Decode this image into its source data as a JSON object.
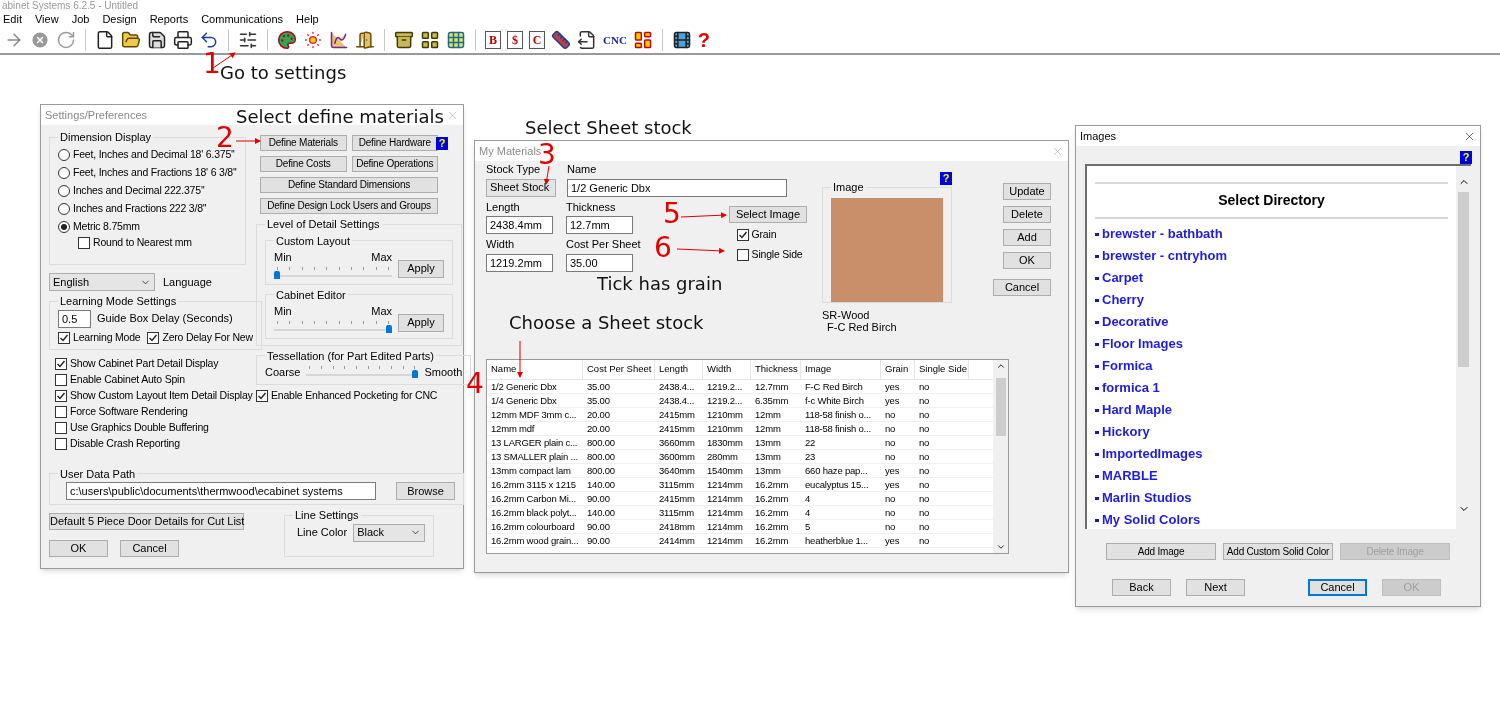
{
  "app": {
    "title": "abinet Systems 6.2.5 - Untitled",
    "menu": [
      "Edit",
      "View",
      "Job",
      "Design",
      "Reports",
      "Communications",
      "Help"
    ],
    "toolbar_glyphs": [
      "B",
      "$",
      "C",
      "CNC",
      "?"
    ]
  },
  "settings": {
    "title": "Settings/Preferences",
    "help": "?",
    "dimension_display": {
      "label": "Dimension Display",
      "options": [
        {
          "label": "Feet, Inches and Decimal 18' 6.375''",
          "selected": false
        },
        {
          "label": "Feet, Inches and Fractions 18' 6 3/8''",
          "selected": false
        },
        {
          "label": "Inches and Decimal 222.375''",
          "selected": false
        },
        {
          "label": "Inches and Fractions 222 3/8''",
          "selected": false
        },
        {
          "label": "Metric 8.75mm",
          "selected": true
        }
      ],
      "round": {
        "label": "Round to Nearest mm",
        "checked": false
      }
    },
    "language": {
      "value": "English",
      "label": "Language"
    },
    "learning": {
      "label": "Learning Mode Settings",
      "delay_value": "0.5",
      "delay_label": "Guide Box Delay (Seconds)",
      "checks": [
        {
          "label": "Learning Mode",
          "checked": true
        },
        {
          "label": "Zero Delay For New",
          "checked": true
        }
      ]
    },
    "options": [
      {
        "label": "Show Cabinet Part Detail Display",
        "checked": true
      },
      {
        "label": "Enable Cabinet Auto Spin",
        "checked": false
      },
      {
        "label": "Show Custom Layout Item Detail Display",
        "checked": true
      },
      {
        "label": "Force Software Rendering",
        "checked": false
      },
      {
        "label": "Use Graphics Double Buffering",
        "checked": false
      },
      {
        "label": "Disable Crash Reporting",
        "checked": false
      }
    ],
    "buttons": [
      "Define Materials",
      "Define Hardware",
      "Define Costs",
      "Define Operations",
      "Define Standard Dimensions",
      "Define Design Lock Users and Groups"
    ],
    "detail": {
      "label": "Level of Detail Settings",
      "sliders": [
        {
          "label": "Custom Layout",
          "min": "Min",
          "max": "Max",
          "level": 0,
          "button": "Apply"
        },
        {
          "label": "Cabinet Editor",
          "min": "Min",
          "max": "Max",
          "level": 1,
          "button": "Apply"
        }
      ]
    },
    "tessellation": {
      "label": "Tessellation (for Part Edited Parts)",
      "min": "Coarse",
      "max": "Smooth",
      "level": 1
    },
    "pocketing": {
      "label": "Enable Enhanced Pocketing for CNC",
      "checked": true
    },
    "user_data_path": {
      "label": "User Data Path",
      "value": "c:\\users\\public\\documents\\thermwood\\ecabinet systems",
      "button": "Browse"
    },
    "door_button": "Default 5 Piece Door Details for Cut List",
    "line_settings": {
      "label": "Line Settings",
      "color_label": "Line Color",
      "color_value": "Black"
    },
    "ok": "OK",
    "cancel": "Cancel"
  },
  "materials": {
    "title": "My Materials",
    "help": "?",
    "stock_type": {
      "label": "Stock Type",
      "value": "Sheet Stock"
    },
    "name": {
      "label": "Name",
      "value": "1/2 Generic Dbx"
    },
    "length": {
      "label": "Length",
      "value": "2438.4mm"
    },
    "thickness": {
      "label": "Thickness",
      "value": "12.7mm"
    },
    "width": {
      "label": "Width",
      "value": "1219.2mm"
    },
    "cost": {
      "label": "Cost Per Sheet",
      "value": "35.00"
    },
    "select_image": "Select Image",
    "grain": {
      "label": "Grain",
      "checked": true
    },
    "single_side": {
      "label": "Single Side",
      "checked": false
    },
    "image": {
      "label": "Image",
      "caption": [
        "SR-Wood",
        "F-C Red Birch"
      ]
    },
    "buttons": [
      "Update",
      "Delete",
      "Add",
      "OK",
      "Cancel"
    ],
    "table": {
      "columns": [
        "Name",
        "Cost Per Sheet",
        "Length",
        "Width",
        "Thickness",
        "Image",
        "Grain",
        "Single Side"
      ],
      "rows": [
        [
          "1/2 Generic Dbx",
          "35.00",
          "2438.4...",
          "1219.2...",
          "12.7mm",
          "F-C Red Birch",
          "yes",
          "no"
        ],
        [
          "1/4 Generic Dbx",
          "35.00",
          "2438.4...",
          "1219.2...",
          "6.35mm",
          "f-c White Birch",
          "yes",
          "no"
        ],
        [
          "12mm MDF 3mm c...",
          "20.00",
          "2415mm",
          "1210mm",
          "12mm",
          "118-58 finish o...",
          "no",
          "no"
        ],
        [
          "12mm mdf",
          "20.00",
          "2415mm",
          "1210mm",
          "12mm",
          "118-58 finish o...",
          "no",
          "no"
        ],
        [
          "13 LARGER plain c...",
          "800.00",
          "3660mm",
          "1830mm",
          "13mm",
          "22",
          "no",
          "no"
        ],
        [
          "13 SMALLER plain ...",
          "800.00",
          "3600mm",
          "280mm",
          "13mm",
          "23",
          "no",
          "no"
        ],
        [
          "13mm compact lam",
          "800.00",
          "3640mm",
          "1540mm",
          "13mm",
          "660 haze pap...",
          "yes",
          "no"
        ],
        [
          "16.2mm 3115 x 1215",
          "140.00",
          "3115mm",
          "1214mm",
          "16.2mm",
          "eucalyptus 15...",
          "yes",
          "no"
        ],
        [
          "16.2mm Carbon Mi...",
          "90.00",
          "2415mm",
          "1214mm",
          "16.2mm",
          "4",
          "no",
          "no"
        ],
        [
          "16.2mm black polyt...",
          "140.00",
          "3115mm",
          "1214mm",
          "16.2mm",
          "4",
          "no",
          "no"
        ],
        [
          "16.2mm colourboard",
          "90.00",
          "2418mm",
          "1214mm",
          "16.2mm",
          "5",
          "no",
          "no"
        ],
        [
          "16.2mm wood grain...",
          "90.00",
          "2414mm",
          "1214mm",
          "16.2mm",
          "heatherblue 1...",
          "yes",
          "no"
        ]
      ]
    }
  },
  "images": {
    "title": "Images",
    "help": "?",
    "heading": "Select Directory",
    "directories": [
      "brewster - bathbath",
      "brewster - cntryhom",
      "Carpet",
      "Cherry",
      "Decorative",
      "Floor Images",
      "Formica",
      "formica 1",
      "Hard Maple",
      "Hickory",
      "ImportedImages",
      "MARBLE",
      "Marlin Studios",
      "My Solid Colors"
    ],
    "buttons": [
      {
        "label": "Add Image",
        "disabled": false
      },
      {
        "label": "Add Custom Solid Color",
        "disabled": false
      },
      {
        "label": "Delete Image",
        "disabled": true
      }
    ],
    "nav_buttons": [
      {
        "label": "Back",
        "disabled": false,
        "focused": false
      },
      {
        "label": "Next",
        "disabled": false,
        "focused": false
      },
      {
        "label": "Cancel",
        "disabled": false,
        "focused": true
      },
      {
        "label": "OK",
        "disabled": true,
        "focused": false
      }
    ]
  },
  "annotations": [
    {
      "number": "1",
      "caption": "Go to settings"
    },
    {
      "number": "2",
      "caption": "Select define materials"
    },
    {
      "number": "3",
      "caption": "Select Sheet stock"
    },
    {
      "number": "5"
    },
    {
      "number": "6",
      "caption": "Tick has grain"
    },
    {
      "number": "4",
      "caption": "Choose a Sheet stock"
    }
  ]
}
